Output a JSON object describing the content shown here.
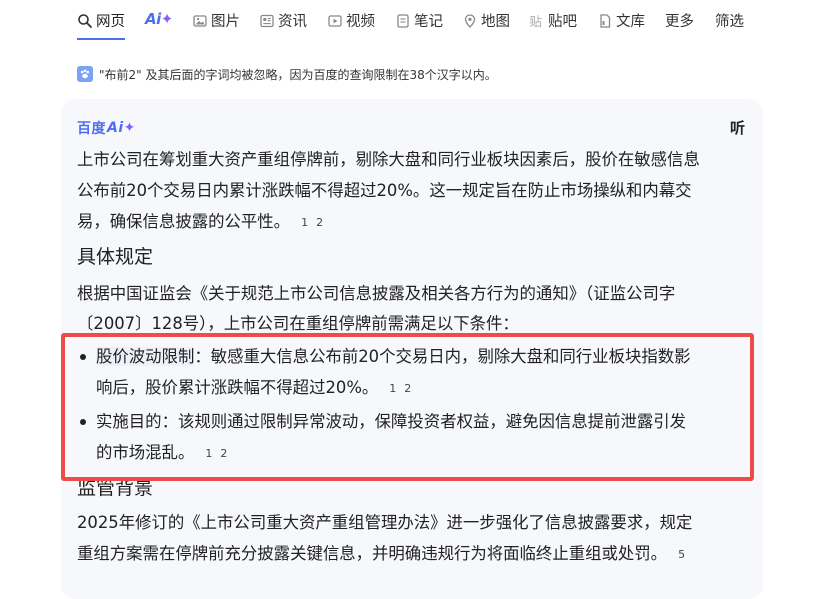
{
  "nav": {
    "tabs": [
      {
        "label": "网页",
        "icon": "search-icon",
        "active": true
      },
      {
        "label": "",
        "icon": "ai-icon"
      },
      {
        "label": "图片",
        "icon": "image-icon"
      },
      {
        "label": "资讯",
        "icon": "news-icon"
      },
      {
        "label": "视频",
        "icon": "video-icon"
      },
      {
        "label": "笔记",
        "icon": "note-icon"
      },
      {
        "label": "地图",
        "icon": "map-icon"
      },
      {
        "label": "贴吧",
        "icon": "tieba-icon"
      },
      {
        "label": "文库",
        "icon": "doc-icon"
      },
      {
        "label": "更多"
      },
      {
        "label": "筛选"
      }
    ],
    "ai_text": "Ai"
  },
  "hint": {
    "text": "\"布前2\" 及其后面的字词均被忽略，因为百度的查询限制在38个汉字以内。"
  },
  "card": {
    "brand_left": "百度",
    "brand_ai": "Ai",
    "listen": "听",
    "intro": {
      "line1": "上市公司在筹划重大资产重组停牌前，剔除大盘和同行业板块因素后，股价在敏感信息",
      "line2": "公布前20个交易日内累计涨跌幅不得超过20%。这一规定旨在防止市场操纵和内幕交",
      "line3": "易，确保信息披露的公平性。",
      "cites": [
        "1",
        "2"
      ]
    },
    "section1": {
      "title": "具体规定",
      "para_line1": "根据中国证监会《关于规范上市公司信息披露及相关各方行为的通知》（证监公司字",
      "para_line2": "〔2007〕128号），上市公司在重组停牌前需满足以下条件：",
      "items": [
        {
          "keyword": "股价波动限制",
          "line1_rest": "：敏感重大信息公布前20个交易日内，剔除大盘和同行业板块指数影",
          "line2": "响后，股价累计涨跌幅不得超过20%。",
          "cites": [
            "1",
            "2"
          ]
        },
        {
          "keyword": "实施目的",
          "line1_rest": "：该规则通过限制异常波动，保障投资者权益，避免因信息提前泄露引发",
          "line2": "的市场混乱。",
          "cites": [
            "1",
            "2"
          ]
        }
      ]
    },
    "section2": {
      "title": "监管背景",
      "line1": "2025年修订的《上市公司重大资产重组管理办法》进一步强化了信息披露要求，规定",
      "line2": "重组方案需在停牌前充分披露关键信息，并明确违规行为将面临终止重组或处罚。",
      "cites": [
        "5"
      ]
    }
  },
  "colors": {
    "accent": "#4e6ef2",
    "ai_star": "#8a5cf6",
    "highlight_border": "#ee4b4b",
    "card_bg": "#f6f8fc"
  }
}
